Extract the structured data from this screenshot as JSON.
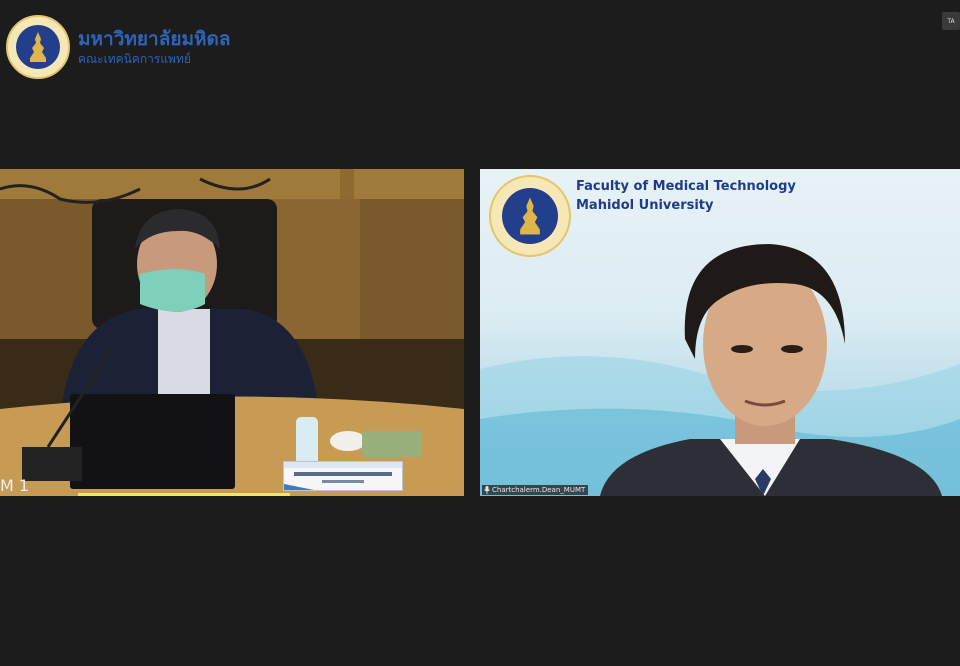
{
  "header": {
    "university_name": "มหาวิทยาลัยมหิดล",
    "faculty_name": "คณะเทคนิคการแพทย์",
    "seal_icon": "mahidol-seal-icon",
    "corner_button_label": "TA"
  },
  "tiles": {
    "left": {
      "room_label": "M 1",
      "active_speaker_color": "#f2e36a"
    },
    "right": {
      "background_title_line1": "Faculty of Medical Technology",
      "background_title_line2": "Mahidol University",
      "participant_name": "Chartchalerm.Dean_MUMT",
      "mic_icon": "microphone-icon"
    }
  },
  "colors": {
    "brand_blue": "#2f63b8",
    "app_background": "#1c1c1c"
  }
}
